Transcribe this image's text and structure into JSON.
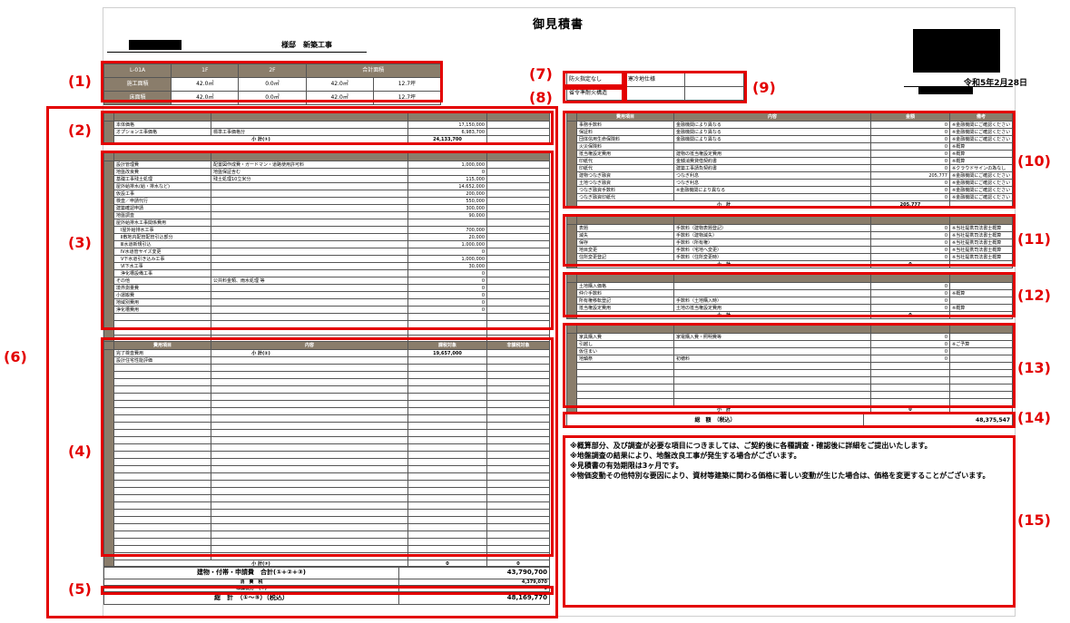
{
  "doc": {
    "title": "御見積書",
    "customer_suffix": "様邸　新築工事",
    "date": "令和5年2月28日"
  },
  "area_table": {
    "plan": "L-01A",
    "cols": [
      "1F",
      "2F",
      "合計面積"
    ],
    "rows": [
      {
        "label": "施工面積",
        "f1": "42.0㎡",
        "f2": "0.0㎡",
        "total_m2": "42.0㎡",
        "tsubo": "12.7坪"
      },
      {
        "label": "床面積",
        "f1": "42.0㎡",
        "f2": "0.0㎡",
        "total_m2": "42.0㎡",
        "tsubo": "12.7坪"
      }
    ]
  },
  "spec": {
    "fire": "防火指定なし",
    "cold": "寒冷地仕様",
    "structure": "省令準耐火構造"
  },
  "markers": {
    "m1": "(1)",
    "m2": "(2)",
    "m3": "(3)",
    "m4": "(4)",
    "m5": "(5)",
    "m6": "(6)",
    "m7": "(7)",
    "m8": "(8)",
    "m9": "(9)",
    "m10": "(10)",
    "m11": "(11)",
    "m12": "(12)",
    "m13": "(13)",
    "m14": "(14)",
    "m15": "(15)"
  },
  "sec2": {
    "side": "建物",
    "rows": [
      {
        "name": "本体価格",
        "detail": "",
        "amount": "17,150,000"
      },
      {
        "name": "オプション工事価格",
        "detail": "標準工事価格分",
        "amount": "6,983,700"
      }
    ],
    "subtotal_label": "小 計(①)",
    "subtotal": "24,133,700"
  },
  "sec3": {
    "side": "付帯工事",
    "rows": [
      {
        "name": "設計管理費",
        "detail": "配置図作成費・ガードマン・道路使用許可料",
        "amount": "1,000,000"
      },
      {
        "name": "地盤改良費",
        "detail": "地盤保証含む",
        "amount": "0"
      },
      {
        "name": "基礎工事残土処理",
        "detail": "残土処理10立米分",
        "amount": "115,000"
      },
      {
        "name": "屋外給排水(給・排水など)",
        "detail": "",
        "amount": "14,652,000"
      },
      {
        "name": "仮設工事",
        "detail": "",
        "amount": "200,000"
      },
      {
        "name": "検査／申請代行",
        "detail": "",
        "amount": "550,000"
      },
      {
        "name": "建築確認申請",
        "detail": "",
        "amount": "300,000"
      },
      {
        "name": "地盤調査",
        "detail": "",
        "amount": "90,000"
      },
      {
        "name": "屋外給排水工事関係費用",
        "detail": "",
        "amount": ""
      },
      {
        "name": "　Ⅰ屋外給排水工事",
        "detail": "",
        "amount": "700,000"
      },
      {
        "name": "　Ⅱ敷地内配管配管引込部分",
        "detail": "",
        "amount": "20,000"
      },
      {
        "name": "　Ⅲ水道新規引込",
        "detail": "",
        "amount": "1,000,000"
      },
      {
        "name": "　Ⅳ水道管サイズ変更",
        "detail": "",
        "amount": "0"
      },
      {
        "name": "　Ⅴ下水道引き込み工事",
        "detail": "",
        "amount": "1,000,000"
      },
      {
        "name": "　Ⅵ下水工事",
        "detail": "",
        "amount": "30,000"
      },
      {
        "name": "　浄化槽設備工事",
        "detail": "",
        "amount": "0"
      },
      {
        "name": "その他",
        "detail": "公共料金類、雨水処理 等",
        "amount": "0"
      },
      {
        "name": "境界測量費",
        "detail": "",
        "amount": "0"
      },
      {
        "name": "小運搬費",
        "detail": "",
        "amount": "0"
      },
      {
        "name": "地域別費用",
        "detail": "",
        "amount": "0"
      },
      {
        "name": "浄化槽費用",
        "detail": "",
        "amount": "0"
      }
    ],
    "subtotal_label": "小 計(②)",
    "subtotal": "19,657,000"
  },
  "sec4": {
    "side": "申請費",
    "headers": [
      "費用項目",
      "内容",
      "課税対象",
      "非課税対象"
    ],
    "rows": [
      {
        "name": "完了検査費用"
      },
      {
        "name": "設計住宅性能評価"
      }
    ],
    "subtotal_label": "小 計(③)",
    "subtotal_a": "0",
    "subtotal_b": "0"
  },
  "totals": {
    "line1_label": "建物・付帯・申請費　合計(①+②+③)",
    "line1": "43,790,700",
    "line2_label": "消　費　税",
    "line2": "4,379,070",
    "line3_label": "非課税分　(④)",
    "line3": "0",
    "line4_label": "総　計　（①～⑤）（税込）",
    "line4": "48,169,770"
  },
  "sec10": {
    "headers": [
      "費用項目",
      "内容",
      "金額",
      "備考"
    ],
    "rows": [
      {
        "name": "事務手数料",
        "detail": "金融機関により異なる",
        "amount": "0",
        "note": "※金融機関にご確認ください"
      },
      {
        "name": "保証料",
        "detail": "金融機関により異なる",
        "amount": "0",
        "note": "※金融機関にご確認ください"
      },
      {
        "name": "団体信用生命保険料",
        "detail": "金融機関により異なる",
        "amount": "0",
        "note": "※金融機関にご確認ください"
      },
      {
        "name": "火災保険料",
        "detail": "",
        "amount": "0",
        "note": "※概算"
      },
      {
        "name": "抵当権設定費用",
        "detail": "建物の抵当権設定費用",
        "amount": "0",
        "note": "※概算"
      },
      {
        "name": "印紙代",
        "detail": "金銭消費貸借契約書",
        "amount": "0",
        "note": "※概算"
      },
      {
        "name": "印紙代",
        "detail": "建築工事請負契約書",
        "amount": "0",
        "note": "※クラウドサインの為なし"
      },
      {
        "name": "建物つなぎ融資",
        "detail": "つなぎ利息",
        "amount": "205,777",
        "note": "※金融機関にご確認ください"
      },
      {
        "name": "土地つなぎ融資",
        "detail": "つなぎ利息",
        "amount": "0",
        "note": "※金融機関にご確認ください"
      },
      {
        "name": "つなぎ融資手数料",
        "detail": "※金融機関により異なる",
        "amount": "0",
        "note": "※金融機関にご確認ください"
      },
      {
        "name": "つなぎ融資印紙代",
        "detail": "",
        "amount": "0",
        "note": "※金融機関にご確認ください"
      }
    ],
    "subtotal_label": "小　計",
    "subtotal": "205,777"
  },
  "sec11": {
    "rows": [
      {
        "name": "表題",
        "detail": "手数料（建物表題登記）",
        "amount": "0",
        "note": "※当社提携司法書士概算"
      },
      {
        "name": "滅失",
        "detail": "手数料（建物滅失）",
        "amount": "0",
        "note": "※当社提携司法書士概算"
      },
      {
        "name": "保存",
        "detail": "手数料（所有権）",
        "amount": "0",
        "note": "※当社提携司法書士概算"
      },
      {
        "name": "地目変更",
        "detail": "手数料（宅地へ変更）",
        "amount": "0",
        "note": "※当社提携司法書士概算"
      },
      {
        "name": "住所変更登記",
        "detail": "手数料（住所変更時）",
        "amount": "0",
        "note": "※当社提携司法書士概算"
      }
    ],
    "subtotal_label": "小　計",
    "subtotal": "0"
  },
  "sec12": {
    "rows": [
      {
        "name": "土地購入価格",
        "detail": "",
        "amount": "0",
        "note": ""
      },
      {
        "name": "仲介手数料",
        "detail": "",
        "amount": "0",
        "note": "※概算"
      },
      {
        "name": "所有権移転登記",
        "detail": "手数料（土地購入時）",
        "amount": "0",
        "note": ""
      },
      {
        "name": "抵当権設定費用",
        "detail": "土地の抵当権設定費用",
        "amount": "0",
        "note": "※概算"
      }
    ],
    "subtotal_label": "小　計",
    "subtotal": "0"
  },
  "sec13": {
    "rows": [
      {
        "name": "家具購入費",
        "detail": "家電購入費・照明費等",
        "amount": "0",
        "note": ""
      },
      {
        "name": "引越し",
        "detail": "",
        "amount": "0",
        "note": "※ご予算"
      },
      {
        "name": "仮住まい",
        "detail": "",
        "amount": "0",
        "note": ""
      },
      {
        "name": "地鎮祭",
        "detail": "初穂料",
        "amount": "0",
        "note": ""
      }
    ],
    "subtotal_label": "小　計",
    "subtotal": "0"
  },
  "sec14": {
    "label": "総　額　（税込）",
    "amount": "48,375,547"
  },
  "notes": "※概算部分、及び調査が必要な項目につきましては、ご契約後に各種調査・確認後に詳細をご提出いたします。\n※地盤調査の結果により、地盤改良工事が発生する場合がございます。\n※見積書の有効期限は3ヶ月です。\n※物価変動その他特別な要因により、資材等建築に関わる価格に著しい変動が生じた場合は、価格を変更することがございます。"
}
